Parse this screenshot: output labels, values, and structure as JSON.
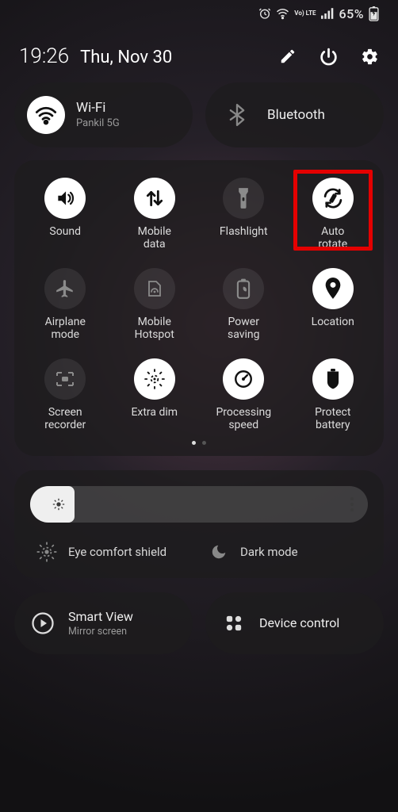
{
  "status": {
    "battery_pct": "65%",
    "network_badge": "Vo) LTE"
  },
  "header": {
    "time": "19:26",
    "date": "Thu, Nov 30"
  },
  "big_tiles": {
    "wifi": {
      "title": "Wi-Fi",
      "subtitle": "Pankil 5G"
    },
    "bluetooth": {
      "title": "Bluetooth"
    }
  },
  "qs": [
    {
      "id": "sound",
      "label": "Sound",
      "on": true,
      "icon": "volume"
    },
    {
      "id": "mobile-data",
      "label": "Mobile\ndata",
      "on": true,
      "icon": "data-arrows"
    },
    {
      "id": "flashlight",
      "label": "Flashlight",
      "on": false,
      "icon": "flashlight"
    },
    {
      "id": "auto-rotate",
      "label": "Auto\nrotate",
      "on": true,
      "icon": "autorotate",
      "highlight": true
    },
    {
      "id": "airplane-mode",
      "label": "Airplane\nmode",
      "on": false,
      "icon": "airplane"
    },
    {
      "id": "mobile-hotspot",
      "label": "Mobile\nHotspot",
      "on": false,
      "icon": "hotspot"
    },
    {
      "id": "power-saving",
      "label": "Power\nsaving",
      "on": false,
      "icon": "leaf-battery"
    },
    {
      "id": "location",
      "label": "Location",
      "on": true,
      "icon": "pin"
    },
    {
      "id": "screen-recorder",
      "label": "Screen\nrecorder",
      "on": false,
      "icon": "recorder"
    },
    {
      "id": "extra-dim",
      "label": "Extra dim",
      "on": true,
      "icon": "dim-sun"
    },
    {
      "id": "processing-speed",
      "label": "Processing\nspeed",
      "on": true,
      "icon": "gauge"
    },
    {
      "id": "protect-battery",
      "label": "Protect\nbattery",
      "on": true,
      "icon": "shield-battery"
    }
  ],
  "brightness": {
    "eye_comfort": "Eye comfort shield",
    "dark_mode": "Dark mode"
  },
  "bottom": {
    "smart_view": {
      "title": "Smart View",
      "subtitle": "Mirror screen"
    },
    "device_control": {
      "title": "Device control"
    }
  }
}
